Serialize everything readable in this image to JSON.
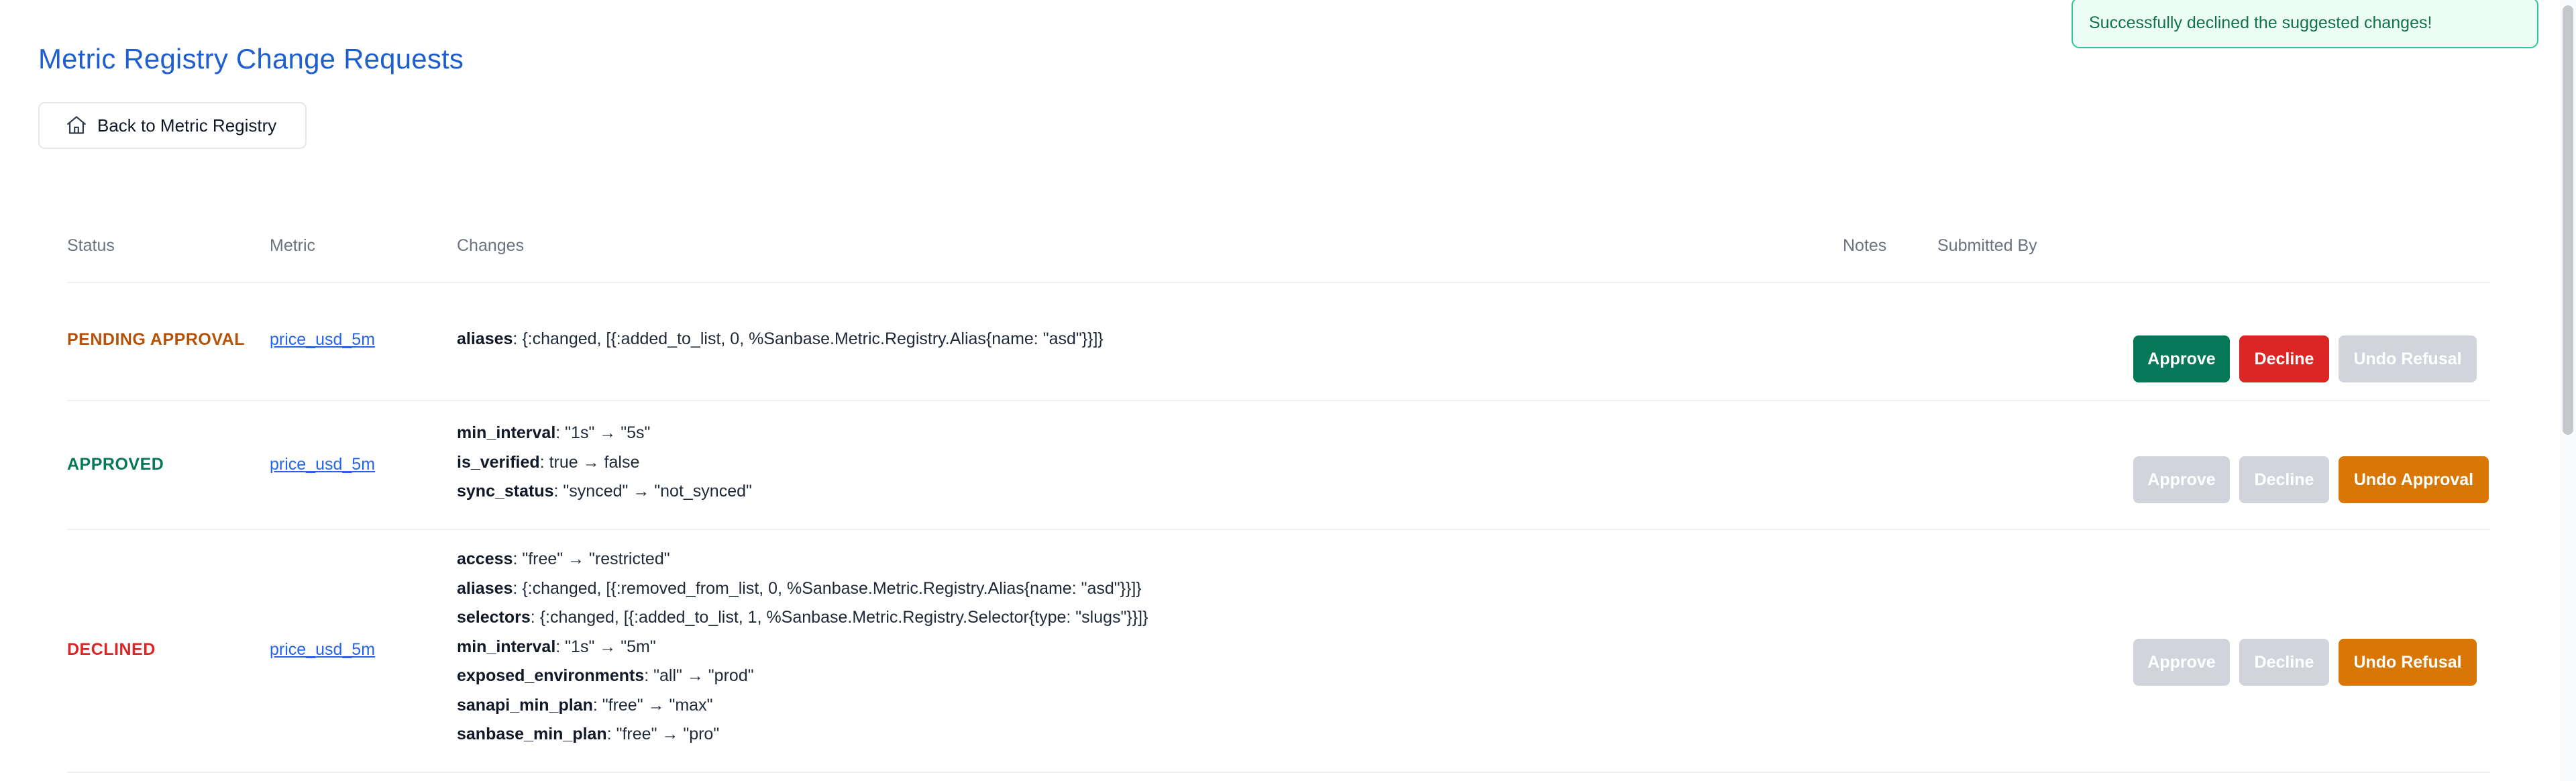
{
  "page": {
    "title": "Metric Registry Change Requests",
    "back_button": {
      "label": "Back to Metric Registry",
      "icon": "home-icon"
    }
  },
  "toast": {
    "message": "Successfully declined the suggested changes!"
  },
  "table": {
    "headers": [
      "Status",
      "Metric",
      "Changes",
      "Notes",
      "Submitted By"
    ],
    "rows": [
      {
        "status": "PENDING APPROVAL",
        "status_color": "#b45309",
        "metric": "price_usd_5m",
        "changes": [
          {
            "key": "aliases",
            "value": ": {:changed, [{:added_to_list, 0, %Sanbase.Metric.Registry.Alias{name: \"asd\"}}]}"
          }
        ],
        "notes": "",
        "submitted_by": "",
        "actions": [
          {
            "label": "Approve",
            "color": "#047857",
            "enabled": true
          },
          {
            "label": "Decline",
            "color": "#dc2626",
            "enabled": true
          },
          {
            "label": "Undo Refusal",
            "color": "#d1d5db",
            "enabled": false
          }
        ]
      },
      {
        "status": "APPROVED",
        "status_color": "#047857",
        "metric": "price_usd_5m",
        "changes": [
          {
            "key": "min_interval",
            "value": ": \"1s\" → \"5s\""
          },
          {
            "key": "is_verified",
            "value": ": true → false"
          },
          {
            "key": "sync_status",
            "value": ": \"synced\" → \"not_synced\""
          }
        ],
        "notes": "",
        "submitted_by": "",
        "actions": [
          {
            "label": "Approve",
            "color": "#d1d5db",
            "enabled": false
          },
          {
            "label": "Decline",
            "color": "#d1d5db",
            "enabled": false
          },
          {
            "label": "Undo Approval",
            "color": "#d97706",
            "enabled": true
          }
        ]
      },
      {
        "status": "DECLINED",
        "status_color": "#dc2626",
        "metric": "price_usd_5m",
        "changes": [
          {
            "key": "access",
            "value": ": \"free\" → \"restricted\""
          },
          {
            "key": "aliases",
            "value": ": {:changed, [{:removed_from_list, 0, %Sanbase.Metric.Registry.Alias{name: \"asd\"}}]}"
          },
          {
            "key": "selectors",
            "value": ": {:changed, [{:added_to_list, 1, %Sanbase.Metric.Registry.Selector{type: \"slugs\"}}]}"
          },
          {
            "key": "min_interval",
            "value": ": \"1s\" → \"5m\""
          },
          {
            "key": "exposed_environments",
            "value": ": \"all\" → \"prod\""
          },
          {
            "key": "sanapi_min_plan",
            "value": ": \"free\" → \"max\""
          },
          {
            "key": "sanbase_min_plan",
            "value": ": \"free\" → \"pro\""
          }
        ],
        "notes": "",
        "submitted_by": "",
        "actions": [
          {
            "label": "Approve",
            "color": "#d1d5db",
            "enabled": false
          },
          {
            "label": "Decline",
            "color": "#d1d5db",
            "enabled": false
          },
          {
            "label": "Undo Refusal",
            "color": "#d97706",
            "enabled": true
          }
        ]
      }
    ]
  }
}
